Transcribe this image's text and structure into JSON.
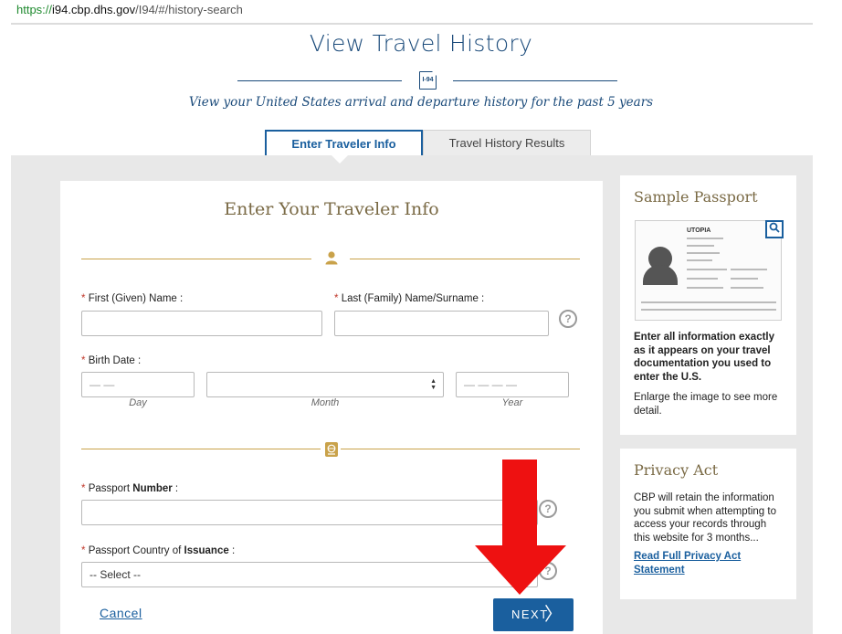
{
  "browser": {
    "url_scheme": "https://",
    "url_host": "i94.cbp.dhs.gov",
    "url_path": "/I94/#/history-search"
  },
  "header": {
    "title": "View Travel History",
    "icon_label": "I-94",
    "subtitle": "View your United States arrival and departure history for the past 5 years"
  },
  "tabs": [
    {
      "label": "Enter Traveler Info",
      "active": true
    },
    {
      "label": "Travel History Results",
      "active": false
    }
  ],
  "form": {
    "title": "Enter Your Traveler Info",
    "first_name_label": "First (Given) Name :",
    "last_name_label": "Last (Family) Name/Surname :",
    "birth_date_label": "Birth Date :",
    "day_placeholder": "— —",
    "year_placeholder": "— — — —",
    "day_sublabel": "Day",
    "month_sublabel": "Month",
    "year_sublabel": "Year",
    "passport_number_label_pre": "Passport ",
    "passport_number_label_bold": "Number",
    "passport_number_label_post": " :",
    "passport_country_label_pre": "Passport Country of ",
    "passport_country_label_bold": "Issuance",
    "passport_country_label_post": " :",
    "country_select_value": "-- Select --",
    "required_marker": "*",
    "help_symbol": "?",
    "cancel_label": "Cancel",
    "next_label": "NEXT",
    "next_chevron": "〉"
  },
  "sidebar": {
    "sample_title": "Sample Passport",
    "passport_country": "UTOPIA",
    "sample_text_bold": "Enter all information exactly as it appears on your travel documentation you used to enter the U.S.",
    "sample_text": "Enlarge the image to see more detail.",
    "privacy_title": "Privacy Act",
    "privacy_text": "CBP will retain the information you submit when attempting to access your records through this website for 3 months...",
    "privacy_link": "Read Full Privacy Act Statement"
  },
  "colors": {
    "brand_blue": "#1a5f9e",
    "heading_blue": "#1a4a7a",
    "gold": "#c9a24a",
    "required_red": "#c0392b",
    "annotation_arrow": "#ee1111"
  }
}
